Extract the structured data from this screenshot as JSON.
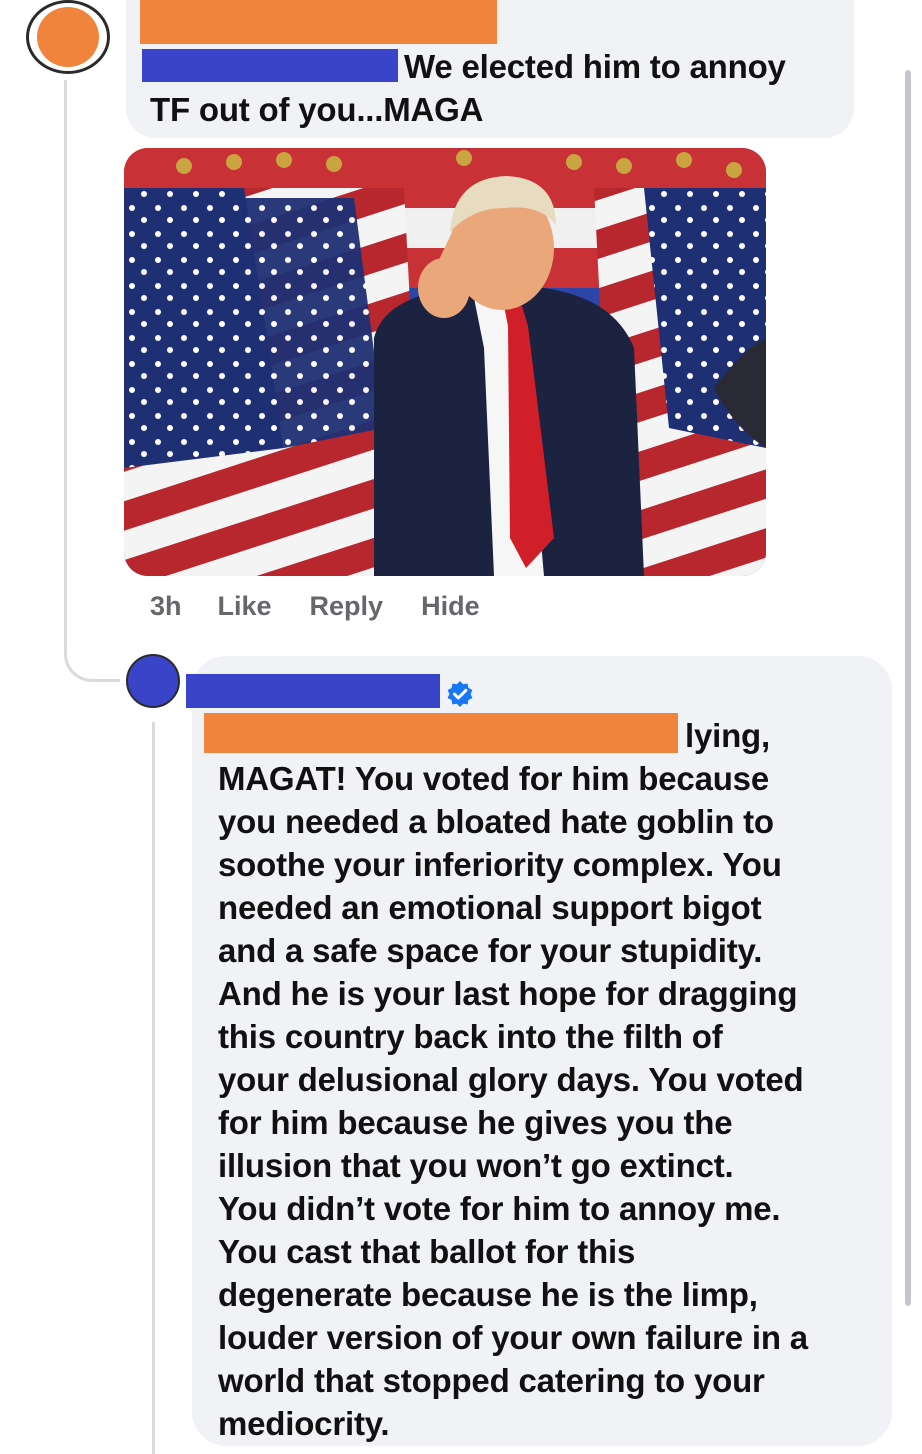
{
  "comment1": {
    "text_line1": "We elected him to annoy",
    "text_line2": "TF out of you...MAGA",
    "actions": {
      "time": "3h",
      "like": "Like",
      "reply": "Reply",
      "hide": "Hide"
    }
  },
  "comment2": {
    "first_line": "lying,",
    "lines": [
      "MAGAT!  You voted for him because",
      "you needed a bloated hate goblin to",
      "soothe your inferiority complex.  You",
      "needed an emotional support bigot",
      "and a safe space for your stupidity.",
      "And he is your last hope for dragging",
      "this country back into the filth of",
      "your delusional glory days. You voted",
      "for him because he gives you the",
      "illusion that you won’t go extinct.",
      "You didn’t vote for him to annoy me.",
      "You cast that ballot for this",
      "degenerate because he is the limp,",
      "louder version of your own failure in a",
      "world that stopped catering to your",
      "mediocrity."
    ]
  },
  "colors": {
    "redact_orange": "#f0843c",
    "redact_blue": "#3a44c9",
    "bubble": "#f0f2f5",
    "verified": "#1877f2"
  }
}
